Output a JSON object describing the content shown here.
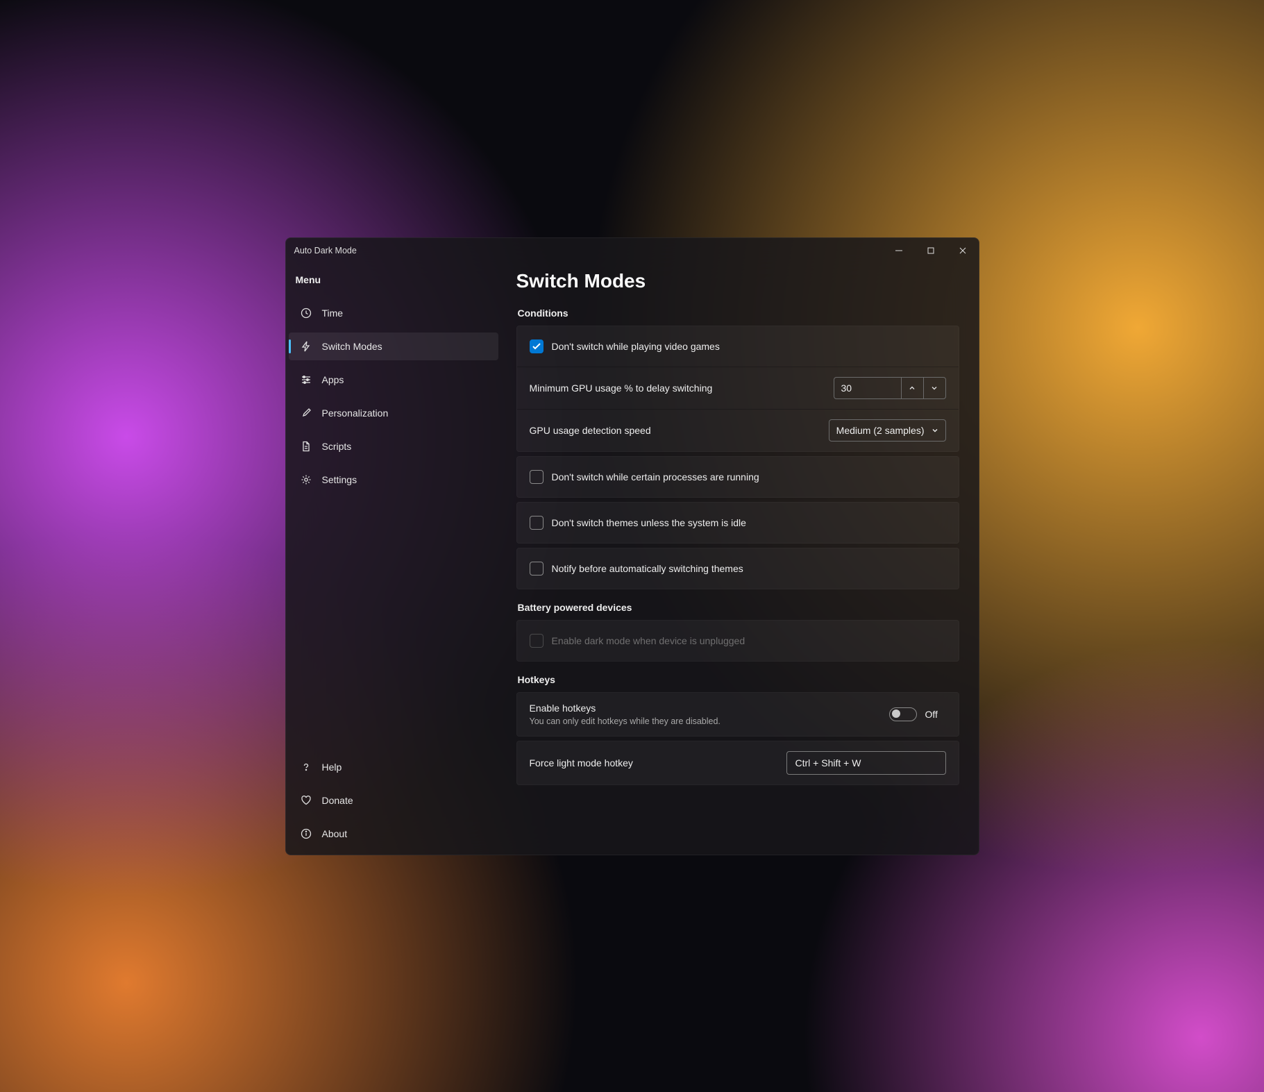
{
  "window": {
    "title": "Auto Dark Mode"
  },
  "sidebar": {
    "menu_label": "Menu",
    "items": [
      {
        "label": "Time"
      },
      {
        "label": "Switch Modes"
      },
      {
        "label": "Apps"
      },
      {
        "label": "Personalization"
      },
      {
        "label": "Scripts"
      },
      {
        "label": "Settings"
      }
    ],
    "footer": [
      {
        "label": "Help"
      },
      {
        "label": "Donate"
      },
      {
        "label": "About"
      }
    ]
  },
  "page": {
    "title": "Switch Modes",
    "sections": {
      "conditions": {
        "title": "Conditions",
        "games": "Don't switch while playing video games",
        "gpu_min": "Minimum GPU usage % to delay switching",
        "gpu_min_value": "30",
        "gpu_speed": "GPU usage detection speed",
        "gpu_speed_value": "Medium (2 samples)",
        "processes": "Don't switch while certain processes are running",
        "idle": "Don't switch themes unless the system is idle",
        "notify": "Notify before automatically switching themes"
      },
      "battery": {
        "title": "Battery powered devices",
        "unplugged": "Enable dark mode when device is unplugged"
      },
      "hotkeys": {
        "title": "Hotkeys",
        "enable": "Enable hotkeys",
        "enable_sub": "You can only edit hotkeys while they are disabled.",
        "enable_state": "Off",
        "force_light": "Force light mode hotkey",
        "force_light_value": "Ctrl + Shift + W"
      }
    }
  }
}
